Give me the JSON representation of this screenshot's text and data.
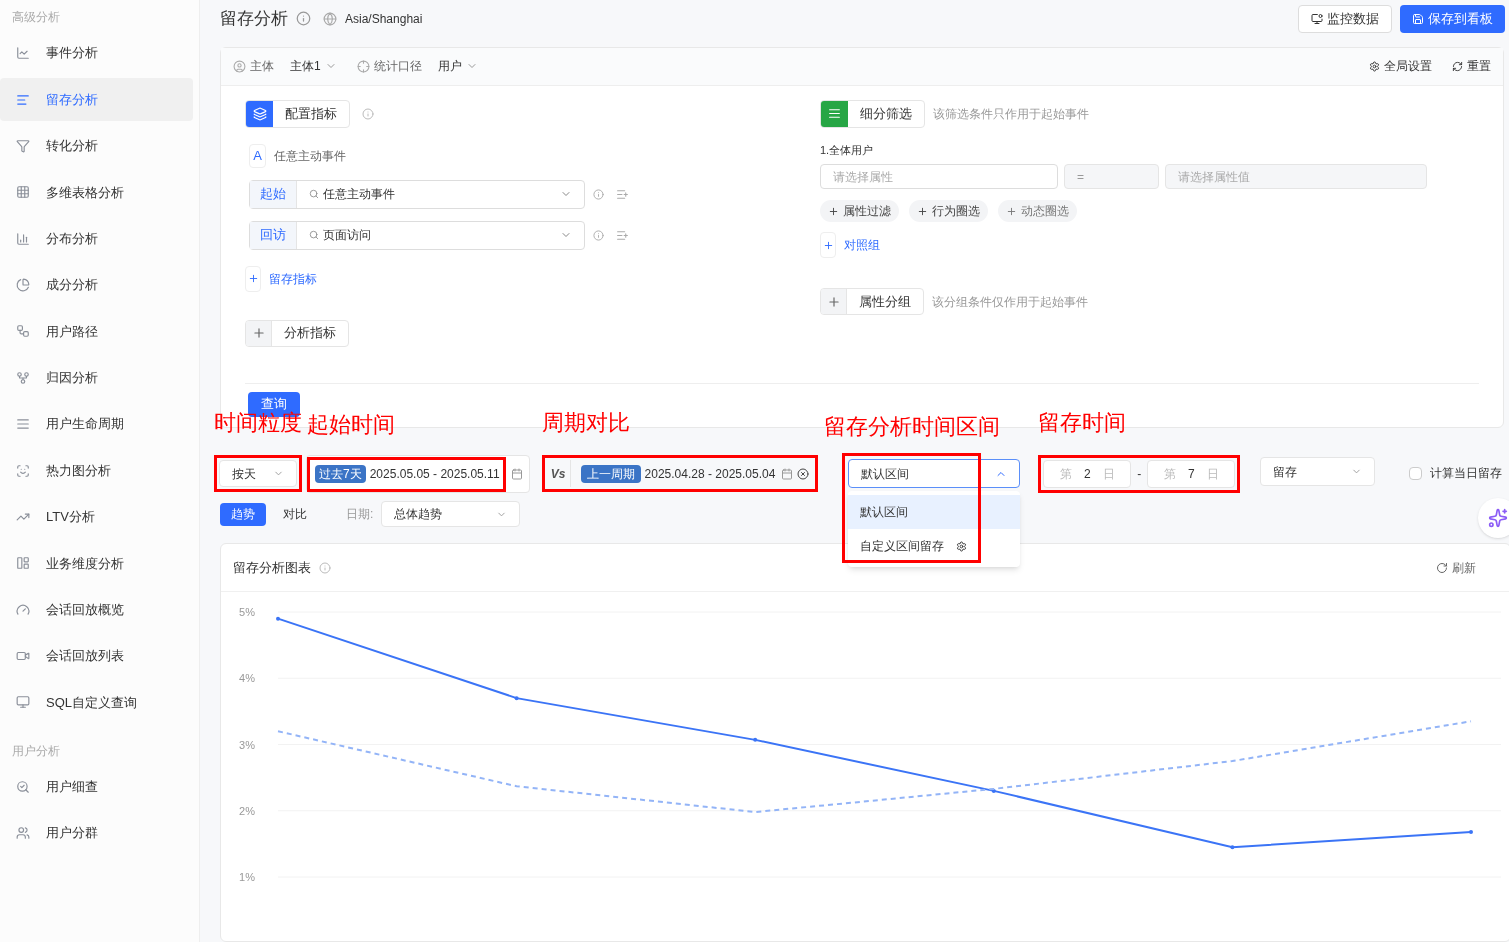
{
  "sidebar": {
    "sections": [
      {
        "title": "高级分析",
        "items": [
          {
            "label": "事件分析",
            "selected": false
          },
          {
            "label": "留存分析",
            "selected": true
          },
          {
            "label": "转化分析",
            "selected": false
          },
          {
            "label": "多维表格分析",
            "selected": false
          },
          {
            "label": "分布分析",
            "selected": false
          },
          {
            "label": "成分分析",
            "selected": false
          },
          {
            "label": "用户路径",
            "selected": false
          },
          {
            "label": "归因分析",
            "selected": false
          },
          {
            "label": "用户生命周期",
            "selected": false
          },
          {
            "label": "热力图分析",
            "selected": false
          },
          {
            "label": "LTV分析",
            "selected": false
          },
          {
            "label": "业务维度分析",
            "selected": false
          },
          {
            "label": "会话回放概览",
            "selected": false
          },
          {
            "label": "会话回放列表",
            "selected": false
          },
          {
            "label": "SQL自定义查询",
            "selected": false
          }
        ]
      },
      {
        "title": "用户分析",
        "items": [
          {
            "label": "用户细查",
            "selected": false
          },
          {
            "label": "用户分群",
            "selected": false
          }
        ]
      }
    ]
  },
  "header": {
    "title": "留存分析",
    "timezone": "Asia/Shanghai",
    "buttons": [
      {
        "label": "监控数据",
        "kind": "secondary"
      },
      {
        "label": "保存到看板",
        "kind": "primary"
      }
    ]
  },
  "toolbar": {
    "subject_label": "主体",
    "subject_value": "主体1",
    "metric_label": "统计口径",
    "metric_value": "用户",
    "actions": [
      "全局设置",
      "重置"
    ]
  },
  "config": {
    "config_button": "配置指标",
    "event_group": {
      "letter": "A",
      "name": "任意主动事件"
    },
    "events": [
      {
        "tag": "起始",
        "value": "任意主动事件"
      },
      {
        "tag": "回访",
        "value": "页面访问"
      }
    ],
    "add_link": "留存指标",
    "analysis_button": "分析指标",
    "query_button": "查询"
  },
  "filters": {
    "filter_button": "细分筛选",
    "filter_hint": "该筛选条件只作用于起始事件",
    "group_title": "1.全体用户",
    "property_placeholder": "请选择属性",
    "operator": "=",
    "value_placeholder": "请选择属性值",
    "chips": [
      "属性过滤",
      "行为圈选",
      "动态圈选"
    ],
    "compare_link": "对照组",
    "group_button": "属性分组",
    "group_hint": "该分组条件仅作用于起始事件"
  },
  "controls": {
    "granularity": {
      "value": "按天",
      "annotation": "时间粒度"
    },
    "date_range": {
      "tag": "过去7天",
      "range": "2025.05.05 - 2025.05.11",
      "annotation": "起始时间"
    },
    "vs": "Vs",
    "compare_range": {
      "tag": "上一周期",
      "range": "2025.04.28 - 2025.05.04",
      "annotation": "周期对比"
    },
    "interval_select": {
      "value": "默认区间",
      "expanded": true,
      "annotation": "留存分析时间区间",
      "options": [
        {
          "label": "默认区间",
          "selected": true
        },
        {
          "label": "自定义区间留存",
          "selected": false
        }
      ]
    },
    "retention_days": {
      "start": {
        "prefix": "第",
        "value": "2",
        "suffix": "日"
      },
      "end": {
        "prefix": "第",
        "value": "7",
        "suffix": "日"
      },
      "separator": "-",
      "annotation": "留存时间"
    },
    "retention_type": "留存",
    "same_day": {
      "label": "计算当日留存",
      "checked": false
    }
  },
  "view": {
    "modes": [
      {
        "label": "趋势",
        "selected": true
      },
      {
        "label": "对比",
        "selected": false
      }
    ],
    "date_label": "日期:",
    "date_select": "总体趋势"
  },
  "chart_card": {
    "title": "留存分析图表",
    "refresh": "刷新",
    "chart_data": {
      "type": "line",
      "grid": true,
      "ylim": [
        1,
        5
      ],
      "yticks": [
        {
          "value": 1,
          "label": "1%"
        },
        {
          "value": 2,
          "label": "2%"
        },
        {
          "value": 3,
          "label": "3%"
        },
        {
          "value": 4,
          "label": "4%"
        },
        {
          "value": 5,
          "label": "5%"
        }
      ],
      "series": [
        {
          "color": "#3b74f6",
          "line_style": "solid",
          "values": [
            4.9,
            3.7,
            3.07,
            2.3,
            1.45,
            1.68
          ]
        },
        {
          "color": "#93b4f7",
          "line_style": "dashed",
          "values": [
            3.2,
            2.37,
            1.98,
            2.33,
            2.75,
            3.35
          ]
        }
      ]
    }
  }
}
